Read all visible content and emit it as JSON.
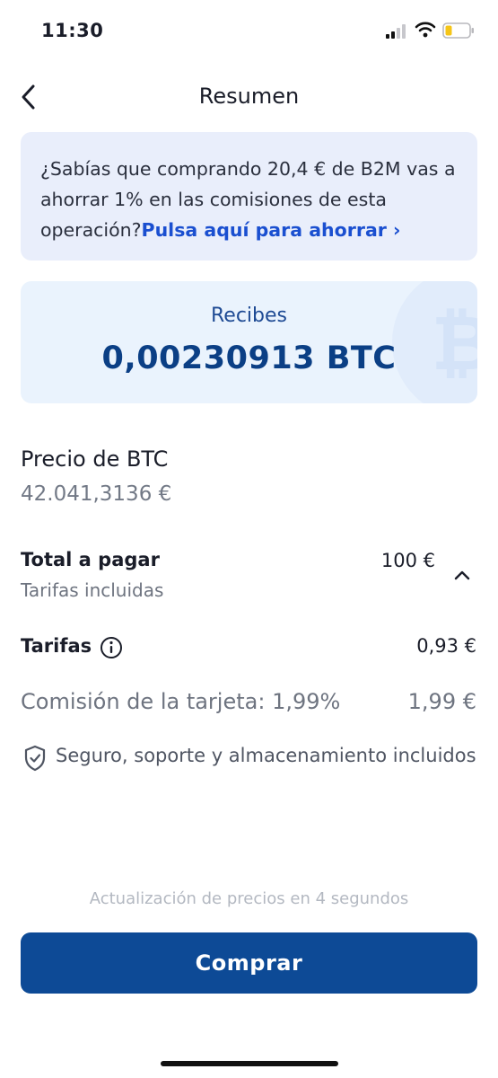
{
  "status_bar": {
    "time": "11:30"
  },
  "header": {
    "title": "Resumen"
  },
  "promo": {
    "text": "¿Sabías que comprando 20,4 € de B2M vas a ahorrar 1% en las comisiones de esta operación?",
    "link": "Pulsa aquí para ahorrar ›"
  },
  "receive": {
    "label": "Recibes",
    "amount": "0,00230913 BTC"
  },
  "price": {
    "label": "Precio de BTC",
    "value": "42.041,3136 €"
  },
  "total": {
    "label": "Total a pagar",
    "sublabel": "Tarifas incluidas",
    "value": "100 €"
  },
  "fees": {
    "label": "Tarifas",
    "value": "0,93 €"
  },
  "card_fee": {
    "label": "Comisión de la tarjeta: 1,99%",
    "value": "1,99 €"
  },
  "security": {
    "text": "Seguro, soporte y almacenamiento incluidos"
  },
  "update_notice": "Actualización de precios en 4 segundos",
  "buy_button": {
    "label": "Comprar"
  },
  "colors": {
    "accent": "#0d4a96",
    "link": "#1a4fd0",
    "promo_bg": "#e9eefb",
    "card_bg": "#eaf3fd",
    "battery": "#f5c518"
  },
  "icons": [
    "signal-icon",
    "wifi-icon",
    "battery-icon",
    "back-arrow-icon",
    "bitcoin-icon",
    "chevron-up-icon",
    "info-icon",
    "shield-check-icon"
  ]
}
